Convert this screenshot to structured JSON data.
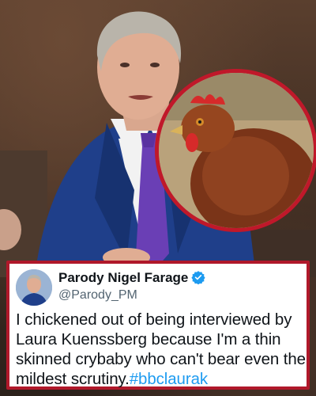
{
  "tweet": {
    "display_name": "Parody Nigel Farage",
    "handle": "@Parody_PM",
    "text": "I chickened out of being interviewed by Laura Kuenssberg because I'm a thin skinned crybaby who can't bear even the mildest scrutiny.",
    "hashtag": "#bbclaurak",
    "verified_badge_color": "#1d9bf0"
  },
  "icons": {
    "verified": "verified-badge-icon",
    "avatar": "avatar"
  },
  "colors": {
    "card_border": "#b0182a",
    "inset_border": "#c0182a",
    "hashtag": "#1d9bf0",
    "suit": "#1f3f8a",
    "tie": "#6a3fb5"
  }
}
